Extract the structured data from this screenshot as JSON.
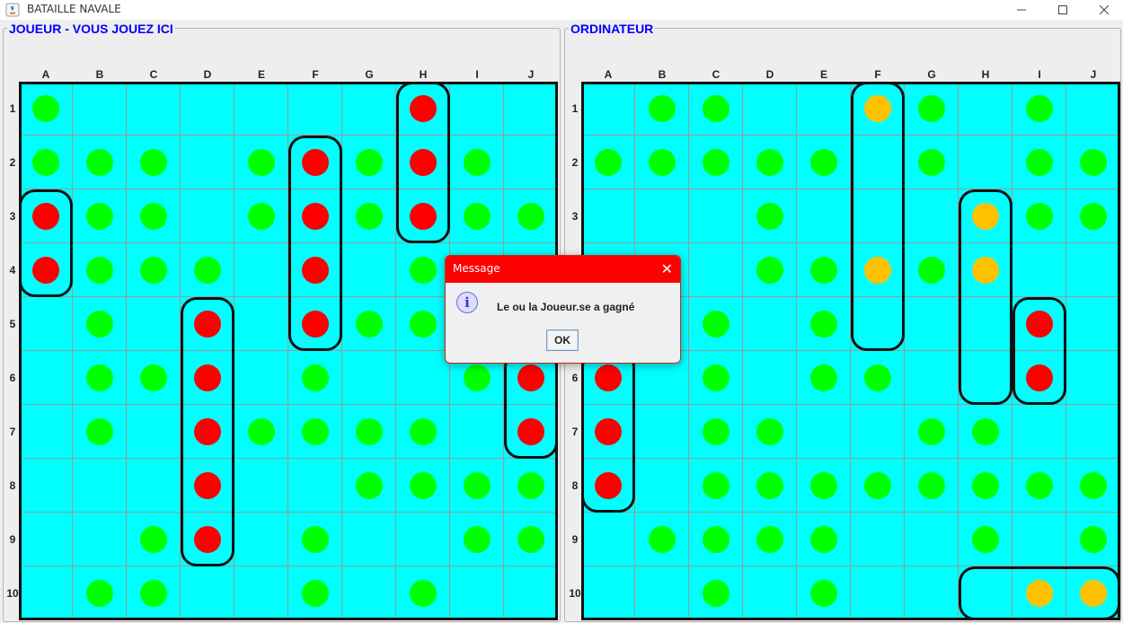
{
  "window": {
    "title": "BATAILLE NAVALE"
  },
  "columns": [
    "A",
    "B",
    "C",
    "D",
    "E",
    "F",
    "G",
    "H",
    "I",
    "J"
  ],
  "rows": [
    "1",
    "2",
    "3",
    "4",
    "5",
    "6",
    "7",
    "8",
    "9",
    "10"
  ],
  "colors": {
    "water": "#00ffff",
    "miss": "#00ff00",
    "hit": "#ff0000",
    "ship_hit_enemy": "#ffc200"
  },
  "player": {
    "title": "JOUEUR - VOUS JOUEZ ICI",
    "cells": [
      [
        "miss",
        "",
        "",
        "",
        "",
        "",
        "",
        "hit",
        "",
        ""
      ],
      [
        "miss",
        "miss",
        "miss",
        "",
        "miss",
        "hit",
        "miss",
        "hit",
        "miss",
        ""
      ],
      [
        "hit",
        "miss",
        "miss",
        "",
        "miss",
        "hit",
        "miss",
        "hit",
        "miss",
        "miss"
      ],
      [
        "hit",
        "miss",
        "miss",
        "miss",
        "",
        "hit",
        "",
        "miss",
        "",
        ""
      ],
      [
        "",
        "miss",
        "",
        "hit",
        "",
        "hit",
        "miss",
        "miss",
        "",
        ""
      ],
      [
        "",
        "miss",
        "miss",
        "hit",
        "",
        "miss",
        "",
        "",
        "miss",
        "hit"
      ],
      [
        "",
        "miss",
        "",
        "hit",
        "miss",
        "miss",
        "miss",
        "miss",
        "",
        "hit"
      ],
      [
        "",
        "",
        "",
        "hit",
        "",
        "",
        "miss",
        "miss",
        "miss",
        "miss"
      ],
      [
        "",
        "",
        "miss",
        "hit",
        "",
        "miss",
        "",
        "",
        "miss",
        "miss"
      ],
      [
        "",
        "miss",
        "miss",
        "",
        "",
        "miss",
        "",
        "miss",
        "",
        ""
      ]
    ],
    "ships": [
      {
        "col": 0,
        "row": 2,
        "len": 2,
        "dir": "v"
      },
      {
        "col": 3,
        "row": 4,
        "len": 5,
        "dir": "v"
      },
      {
        "col": 5,
        "row": 1,
        "len": 4,
        "dir": "v"
      },
      {
        "col": 7,
        "row": 0,
        "len": 3,
        "dir": "v"
      },
      {
        "col": 9,
        "row": 5,
        "len": 2,
        "dir": "v"
      }
    ]
  },
  "computer": {
    "title": "ORDINATEUR",
    "cells": [
      [
        "",
        "miss",
        "miss",
        "",
        "",
        "sunk",
        "miss",
        "",
        "miss",
        ""
      ],
      [
        "miss",
        "miss",
        "miss",
        "miss",
        "miss",
        "",
        "miss",
        "",
        "miss",
        "miss"
      ],
      [
        "",
        "",
        "",
        "miss",
        "",
        "",
        "",
        "sunk",
        "miss",
        "miss"
      ],
      [
        "",
        "",
        "",
        "miss",
        "miss",
        "sunk",
        "miss",
        "sunk",
        "",
        ""
      ],
      [
        "",
        "",
        "miss",
        "",
        "miss",
        "",
        "",
        "",
        "hit",
        ""
      ],
      [
        "hit",
        "",
        "miss",
        "",
        "miss",
        "miss",
        "",
        "",
        "hit",
        ""
      ],
      [
        "hit",
        "",
        "miss",
        "miss",
        "",
        "",
        "miss",
        "miss",
        "",
        ""
      ],
      [
        "hit",
        "",
        "miss",
        "miss",
        "miss",
        "miss",
        "miss",
        "miss",
        "miss",
        "miss"
      ],
      [
        "",
        "miss",
        "miss",
        "miss",
        "miss",
        "",
        "",
        "miss",
        "",
        "miss"
      ],
      [
        "",
        "",
        "miss",
        "",
        "miss",
        "",
        "",
        "",
        "sunk",
        "sunk"
      ]
    ],
    "ships": [
      {
        "col": 0,
        "row": 5,
        "len": 3,
        "dir": "v"
      },
      {
        "col": 5,
        "row": 0,
        "len": 5,
        "dir": "v"
      },
      {
        "col": 7,
        "row": 2,
        "len": 4,
        "dir": "v"
      },
      {
        "col": 8,
        "row": 4,
        "len": 2,
        "dir": "v"
      },
      {
        "col": 7,
        "row": 9,
        "len": 3,
        "dir": "h"
      }
    ]
  },
  "dialog": {
    "title": "Message",
    "message": "Le ou la Joueur.se a gagné",
    "ok_label": "OK",
    "icon": "info-icon"
  }
}
